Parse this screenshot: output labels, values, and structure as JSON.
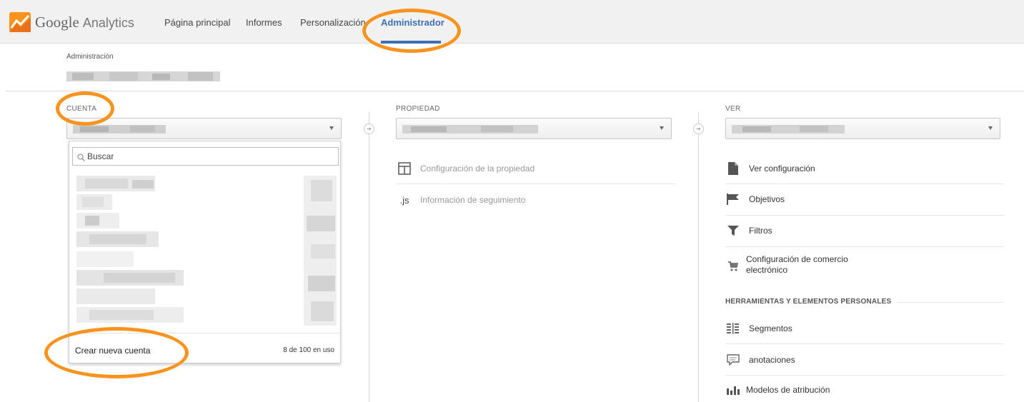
{
  "brand": {
    "logo_text": "Google",
    "product": "Analytics"
  },
  "nav": [
    {
      "label": "Página principal"
    },
    {
      "label": "Informes"
    },
    {
      "label": "Personalización"
    },
    {
      "label": "Administrador",
      "active": true
    }
  ],
  "breadcrumb": "Administración",
  "account": {
    "label": "CUENTA",
    "search_placeholder": "Buscar",
    "create_label": "Crear nueva cuenta",
    "usage": "8 de 100 en uso"
  },
  "property": {
    "label": "PROPIEDAD",
    "items": [
      {
        "label": "Configuración de la propiedad",
        "icon": "layout-icon"
      },
      {
        "label": "Información de seguimiento",
        "icon": "js-icon",
        "icon_text": ".js"
      }
    ]
  },
  "view": {
    "label": "VER",
    "items": [
      {
        "label": "Ver configuración",
        "icon": "document-icon"
      },
      {
        "label": "Objetivos",
        "icon": "flag-icon"
      },
      {
        "label": "Filtros",
        "icon": "filter-icon"
      },
      {
        "label": "Configuración de comercio\nelectrónico",
        "icon": "cart-icon"
      }
    ],
    "tools_heading": "HERRAMIENTAS Y ELEMENTOS PERSONALES",
    "tools": [
      {
        "label": "Segmentos",
        "icon": "segments-icon"
      },
      {
        "label": "anotaciones",
        "icon": "comment-icon"
      },
      {
        "label": "Modelos de atribución",
        "icon": "bar-chart-icon"
      }
    ]
  },
  "colors": {
    "accent": "#3f6fb3",
    "highlight": "#f7931e"
  }
}
